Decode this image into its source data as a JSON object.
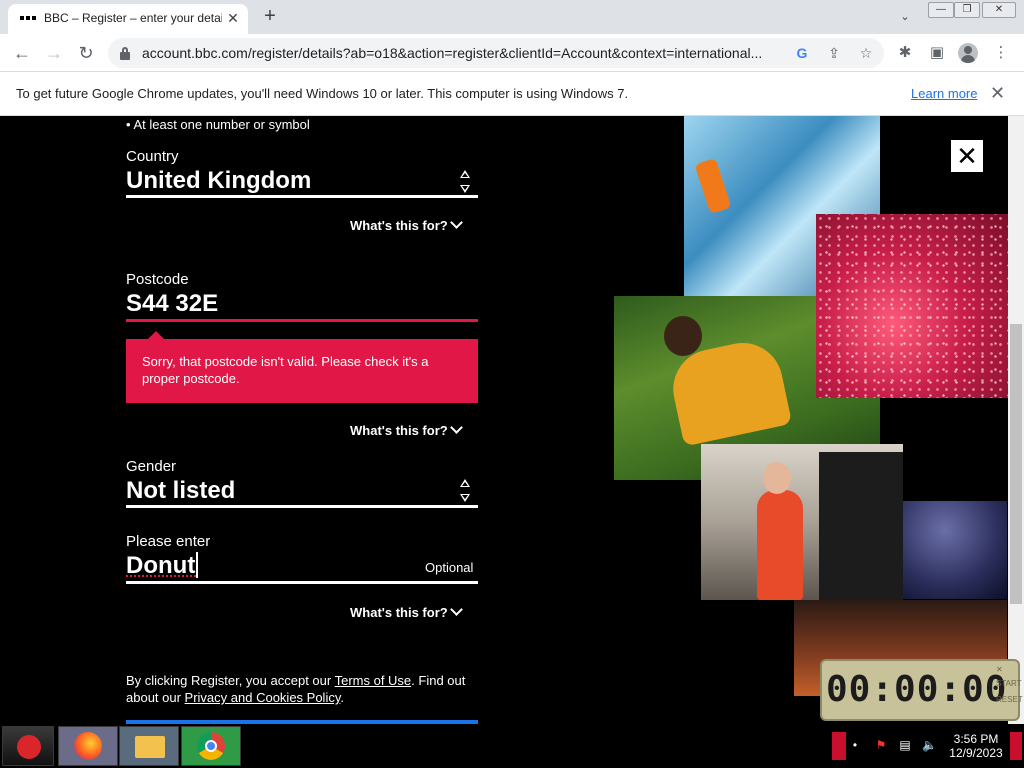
{
  "browser": {
    "tab_title": "BBC – Register – enter your details",
    "tab_close": "✕",
    "new_tab": "+",
    "tab_search": "⌄",
    "window_controls": {
      "minimize": "—",
      "restore": "❐",
      "close": "✕"
    },
    "nav": {
      "back": "←",
      "forward": "→",
      "reload": "↻"
    },
    "url": "account.bbc.com/register/details?ab=o18&action=register&clientId=Account&context=international...",
    "omnibox_icons": {
      "google": "G",
      "share": "⇪",
      "bookmark": "☆"
    },
    "toolbar_icons": {
      "extensions": "✱",
      "sidepanel": "▣",
      "menu": "⋮"
    }
  },
  "infobar": {
    "message": "To get future Google Chrome updates, you'll need Windows 10 or later. This computer is using Windows 7.",
    "link": "Learn more",
    "close": "✕"
  },
  "form": {
    "password_requirement": "• At least one number or symbol",
    "country": {
      "label": "Country",
      "value": "United Kingdom",
      "help": "What's this for?"
    },
    "postcode": {
      "label": "Postcode",
      "value": "S44 32E",
      "error": "Sorry, that postcode isn't valid. Please check it's a proper postcode.",
      "help": "What's this for?"
    },
    "gender": {
      "label": "Gender",
      "value": "Not listed"
    },
    "gender_other": {
      "label": "Please enter",
      "value": "Donut",
      "optional": "Optional",
      "help": "What's this for?"
    },
    "legal": {
      "prefix": "By clicking Register, you accept our ",
      "terms": "Terms of Use",
      "middle": ". Find out about our ",
      "privacy": "Privacy and Cookies Policy",
      "suffix": "."
    },
    "close_label": "✕"
  },
  "timer": {
    "display": "00:00:00",
    "start": "START",
    "reset": "RESET",
    "close": "✕"
  },
  "taskbar": {
    "clock_time": "3:56 PM",
    "clock_date": "12/9/2023",
    "tray": {
      "flag": "⚑",
      "network": "▤",
      "volume": "🔈"
    }
  }
}
